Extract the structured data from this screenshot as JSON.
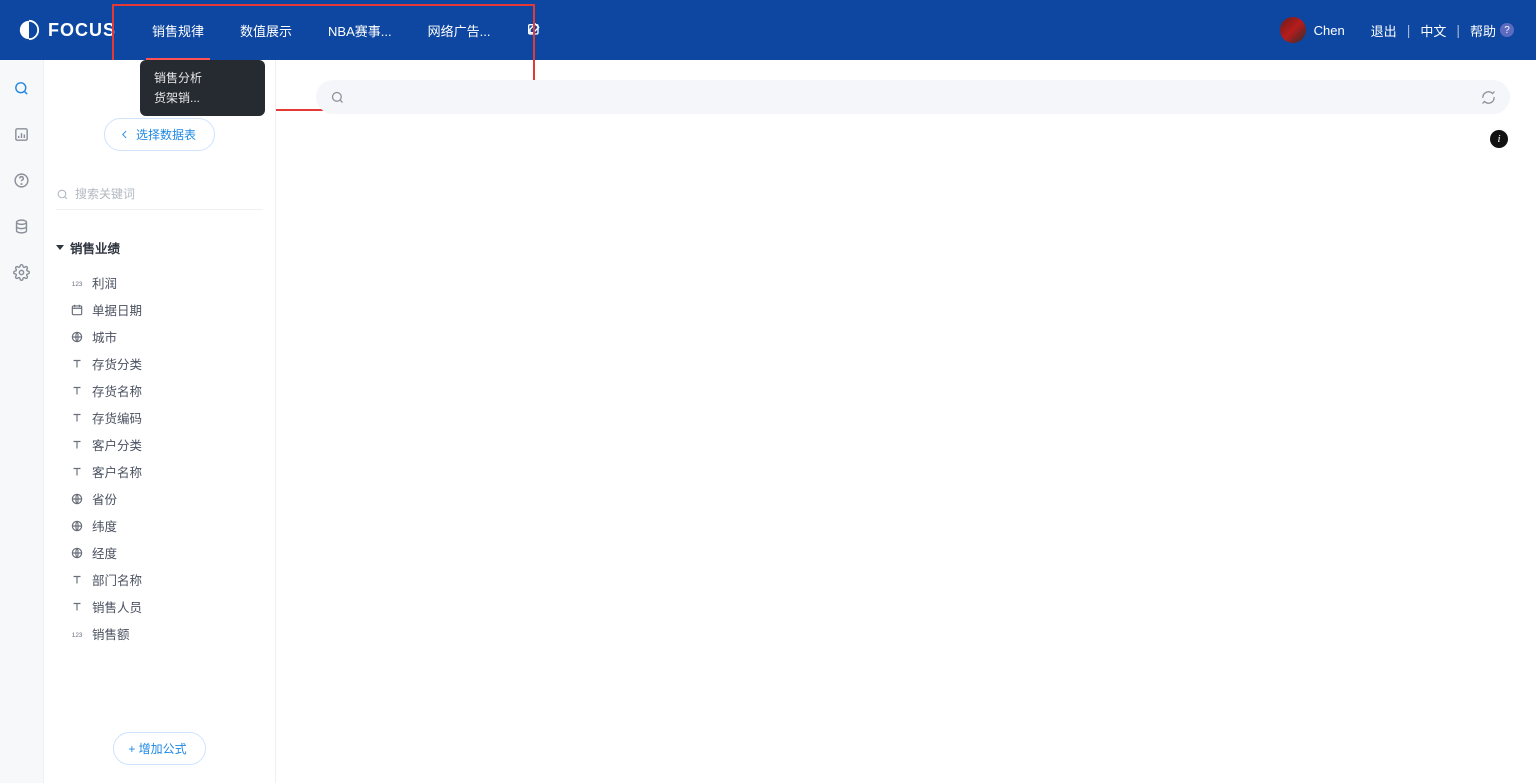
{
  "brand": "FOCUS",
  "header": {
    "tabs": [
      {
        "label": "销售规律",
        "active": true
      },
      {
        "label": "数值展示",
        "active": false
      },
      {
        "label": "NBA赛事...",
        "active": false
      },
      {
        "label": "网络广告...",
        "active": false
      }
    ],
    "tooltip": [
      "销售分析",
      "货架销..."
    ],
    "user_name": "Chen",
    "logout": "退出",
    "lang": "中文",
    "help": "帮助"
  },
  "side": {
    "select_table": "选择数据表",
    "search_placeholder": "搜索关键词",
    "tree_title": "销售业绩",
    "fields": [
      {
        "icon": "num",
        "label": "利润"
      },
      {
        "icon": "date",
        "label": "单据日期"
      },
      {
        "icon": "geo",
        "label": "城市"
      },
      {
        "icon": "text",
        "label": "存货分类"
      },
      {
        "icon": "text",
        "label": "存货名称"
      },
      {
        "icon": "text",
        "label": "存货编码"
      },
      {
        "icon": "text",
        "label": "客户分类"
      },
      {
        "icon": "text",
        "label": "客户名称"
      },
      {
        "icon": "geo",
        "label": "省份"
      },
      {
        "icon": "geo",
        "label": "纬度"
      },
      {
        "icon": "geo",
        "label": "经度"
      },
      {
        "icon": "text",
        "label": "部门名称"
      },
      {
        "icon": "text",
        "label": "销售人员"
      },
      {
        "icon": "num",
        "label": "销售额"
      }
    ],
    "add_formula": "+  增加公式"
  },
  "main": {
    "search_placeholder": ""
  }
}
